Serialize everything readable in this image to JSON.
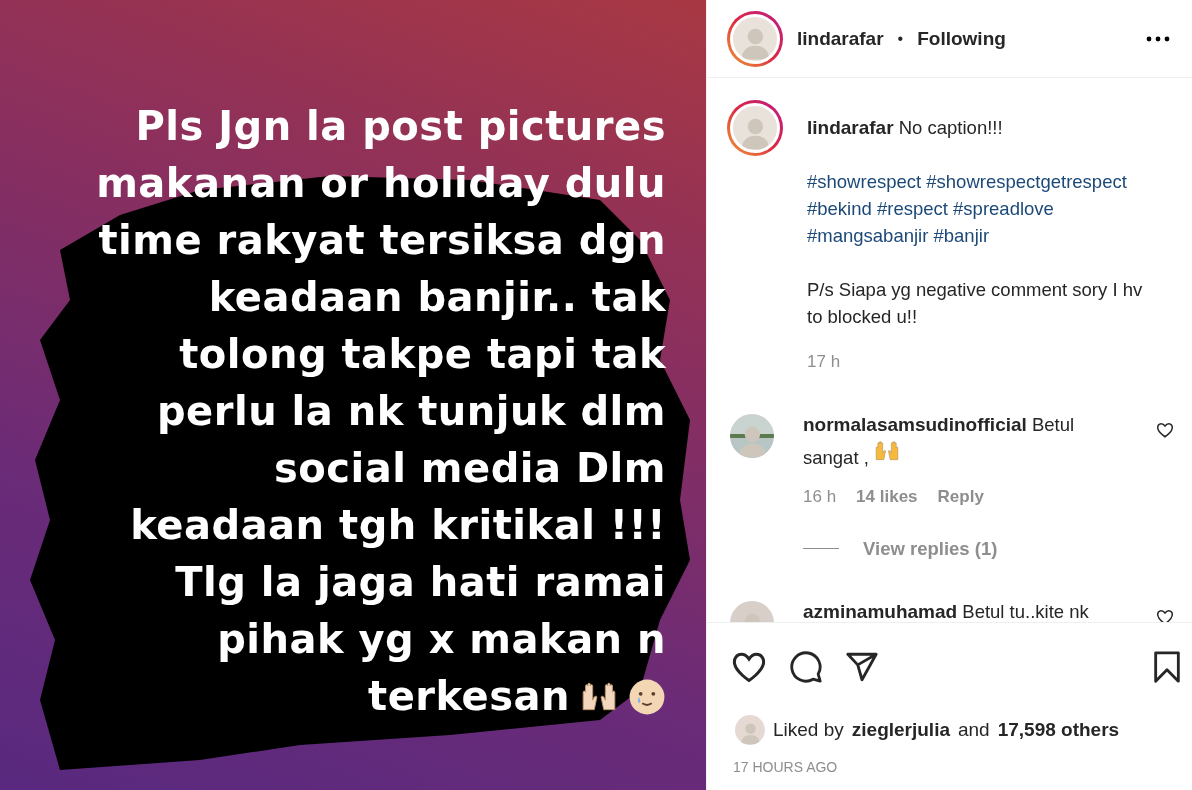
{
  "post_image": {
    "lines": [
      "Pls Jgn la post pictures",
      "makanan or holiday dulu",
      "time rakyat tersiksa dgn",
      "keadaan banjir.. tak",
      "tolong takpe tapi tak",
      "perlu la nk tunjuk dlm",
      "social media Dlm",
      "keadaan tgh kritikal !!!",
      "Tlg la jaga hati ramai",
      "pihak yg x makan n",
      "terkesan"
    ]
  },
  "header": {
    "username": "lindarafar",
    "separator": "•",
    "follow_status": "Following"
  },
  "caption": {
    "username": "lindarafar",
    "text": "No caption!!!",
    "hashtag_lines": [
      [
        "#showrespect",
        "#showrespectgetrespect"
      ],
      [
        "#bekind",
        "#respect",
        "#spreadlove"
      ],
      [
        "#mangsabanjir",
        "#banjir"
      ]
    ],
    "note": "P/s Siapa yg negative comment sory I hv to blocked u!!",
    "time": "17 h"
  },
  "comments": [
    {
      "username": "normalasamsudinofficial",
      "text": "Betul sangat ,",
      "liked": false,
      "time": "16 h",
      "likes": "14 likes",
      "reply": "Reply",
      "view_replies": "View replies (1)"
    },
    {
      "username": "azminamuhamad",
      "text": "Betul tu..kite nk",
      "liked": false
    }
  ],
  "actions": {
    "liked": false,
    "saved": false
  },
  "likes": {
    "prefix": "Liked by",
    "user": "zieglerjulia",
    "middle": "and",
    "count": "17,598 others"
  },
  "time": "17 HOURS AGO"
}
